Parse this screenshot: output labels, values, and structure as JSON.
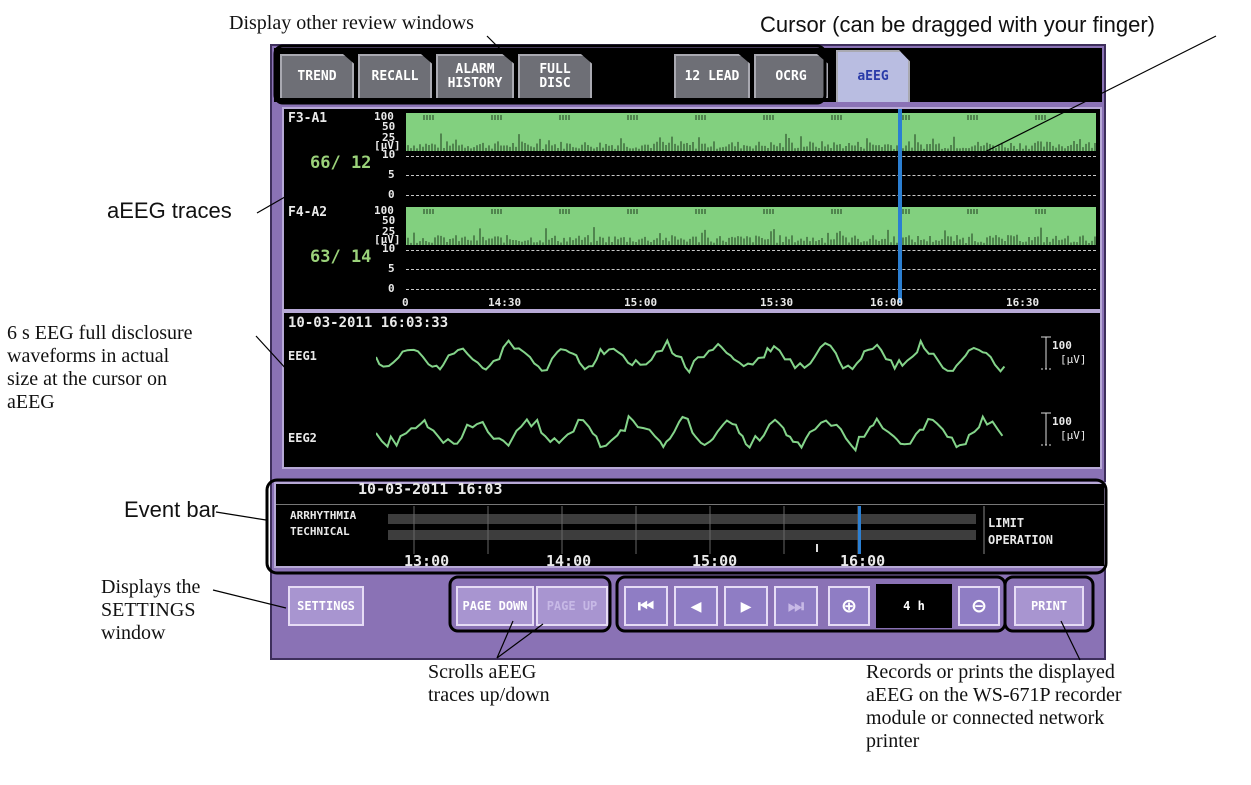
{
  "annotations": {
    "review_windows": "Display other review windows",
    "cursor": "Cursor (can be dragged with your finger)",
    "aeeg_traces": "aEEG traces",
    "full_disclosure": [
      "6 s EEG full disclosure",
      "waveforms in actual",
      "size at the cursor on",
      "aEEG"
    ],
    "event_bar": "Event bar",
    "settings": [
      "Displays the",
      "SETTINGS",
      "window"
    ],
    "scroll": [
      "Scrolls aEEG",
      "traces up/down"
    ],
    "print": [
      "Records or prints the displayed",
      "aEEG on the WS-671P recorder",
      "module or connected network",
      "printer"
    ]
  },
  "tabs": {
    "trend": "TREND",
    "recall": "RECALL",
    "alarm_history": [
      "ALARM",
      "HISTORY"
    ],
    "full_disc": "FULL DISC",
    "lead12": "12 LEAD",
    "ocrg": "OCRG",
    "aeeg": "aEEG"
  },
  "traces": {
    "ch1": {
      "label": "F3-A1",
      "values": "66/  12"
    },
    "ch2": {
      "label": "F4-A2",
      "values": "63/  14"
    },
    "unit": "[μV]",
    "y_ticks": [
      "100",
      "50",
      "25",
      "10",
      "5",
      "0"
    ],
    "x_ticks": [
      "0",
      "14:30",
      "15:00",
      "15:30",
      "16:00",
      "16:30"
    ]
  },
  "eeg": {
    "timestamp": "10-03-2011 16:03:33",
    "ch1": "EEG1",
    "ch2": "EEG2",
    "scale_value": "100",
    "scale_unit": "[μV]"
  },
  "event_bar": {
    "timestamp": "10-03-2011 16:03",
    "left_labels": [
      "ARRHYTHMIA",
      "TECHNICAL"
    ],
    "right_labels": [
      "LIMIT",
      "OPERATION"
    ],
    "time_ticks": [
      "13:00",
      "14:00",
      "15:00",
      "16:00"
    ]
  },
  "buttons": {
    "settings": "SETTINGS",
    "page_down": "PAGE DOWN",
    "page_up": "PAGE UP",
    "first": "⏮",
    "prev": "◀",
    "next": "▶",
    "last": "⏭",
    "zoom_in": "⊕",
    "span": "4 h",
    "zoom_out": "⊖",
    "print": "PRINT"
  },
  "colors": {
    "panel": "#8a72b5",
    "trace_band": "#82d07f",
    "cursor": "#2b7fd2",
    "wave": "#84d48a"
  }
}
